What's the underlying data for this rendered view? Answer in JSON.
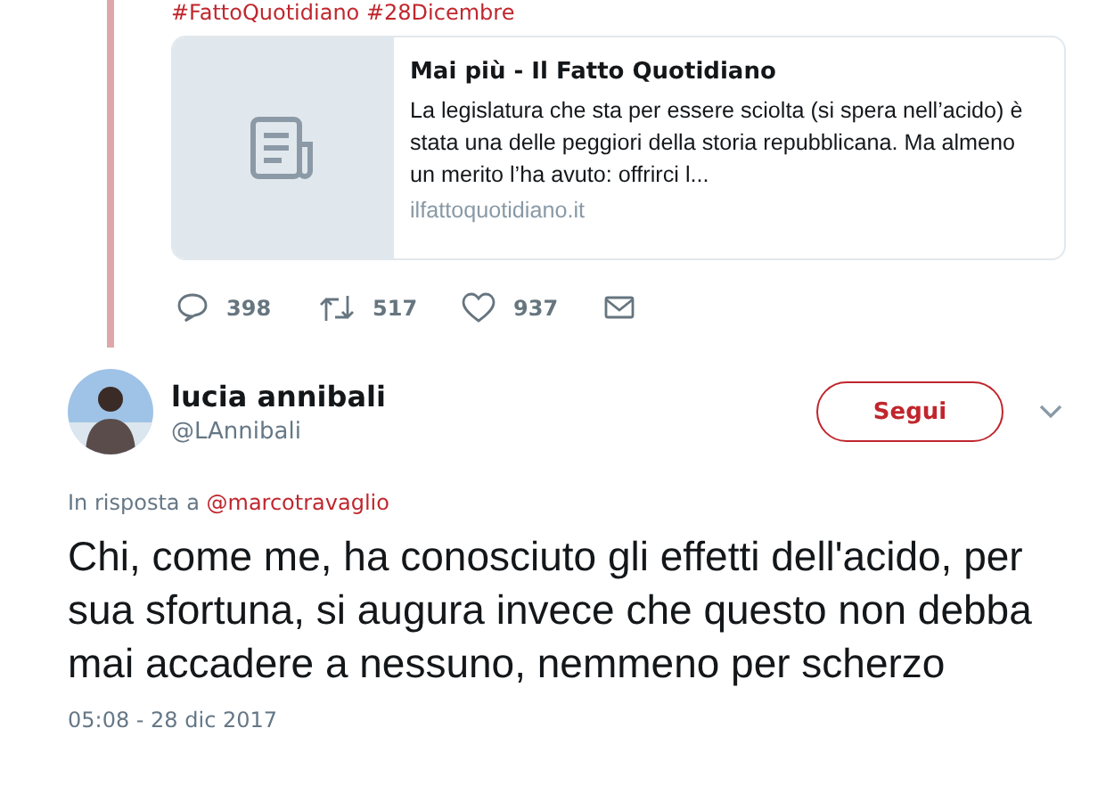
{
  "parent_tweet": {
    "hashtags": "#FattoQuotidiano #28Dicembre",
    "card": {
      "title": "Mai più - Il Fatto Quotidiano",
      "description": "La legislatura che sta per essere sciolta (si spera nell’acido) è stata una delle peggiori della storia repubblicana. Ma almeno un merito l’ha avuto: offrirci l...",
      "domain": "ilfattoquotidiano.it"
    },
    "actions": [
      {
        "kind": "reply",
        "count": "398"
      },
      {
        "kind": "retweet",
        "count": "517"
      },
      {
        "kind": "like",
        "count": "937"
      },
      {
        "kind": "message"
      }
    ]
  },
  "tweet": {
    "name": "lucia annibali",
    "handle": "@LAnnibali",
    "follow_button": "Segui",
    "reply_prefix": "In risposta a",
    "reply_to": "@marcotravaglio",
    "text": "Chi, come me, ha conosciuto gli effetti dell'acido, per sua sfortuna, si augura invece che questo non debba mai accadere a nessuno, nemmeno per scherzo",
    "timestamp": "05:08 - 28 dic 2017"
  }
}
